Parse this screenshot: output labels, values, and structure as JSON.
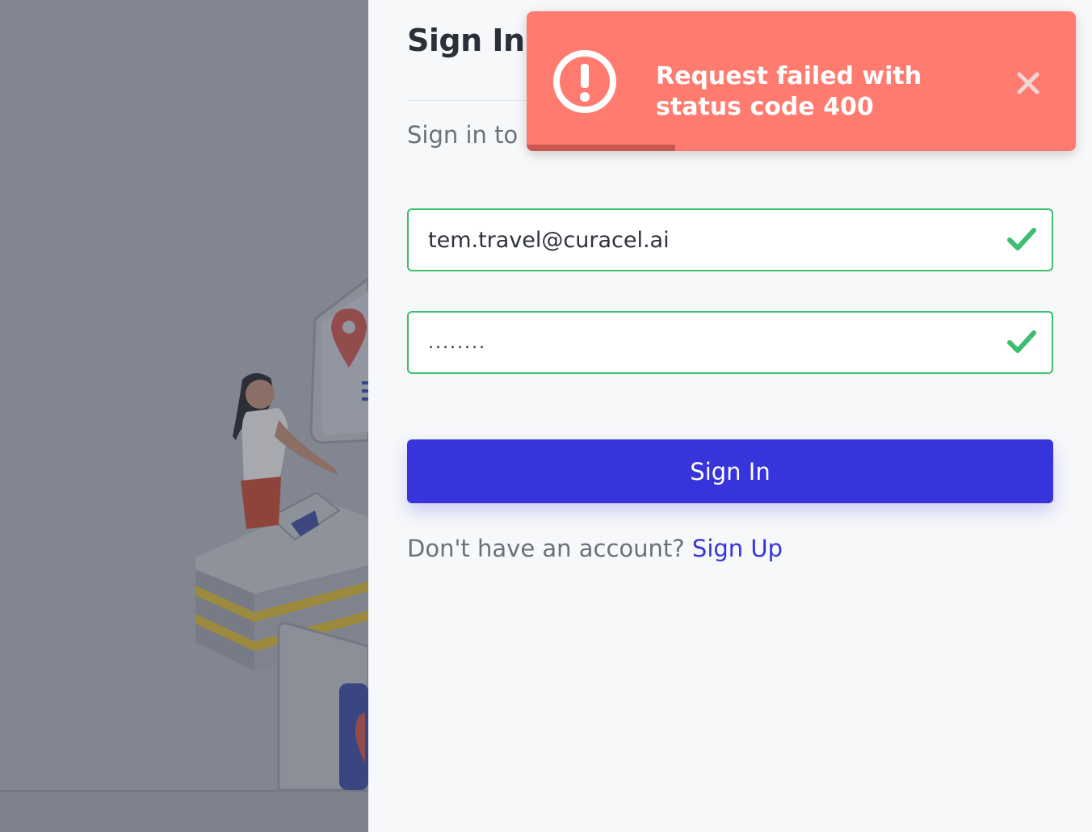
{
  "auth": {
    "title": "Sign In",
    "subtitle": "Sign in to c",
    "email_value": "tem.travel@curacel.ai",
    "password_value": "........",
    "submit_label": "Sign In",
    "no_account_text": "Don't have an account?",
    "signup_link_label": "Sign Up"
  },
  "toast": {
    "message": "Request failed with status code 400",
    "icon": "alert-circle-icon",
    "close_icon": "close-icon",
    "progress": 0.27
  },
  "colors": {
    "brand": "#3734db",
    "success": "#3dbd6e",
    "error": "#ff7b70",
    "overlay": "#818690"
  }
}
